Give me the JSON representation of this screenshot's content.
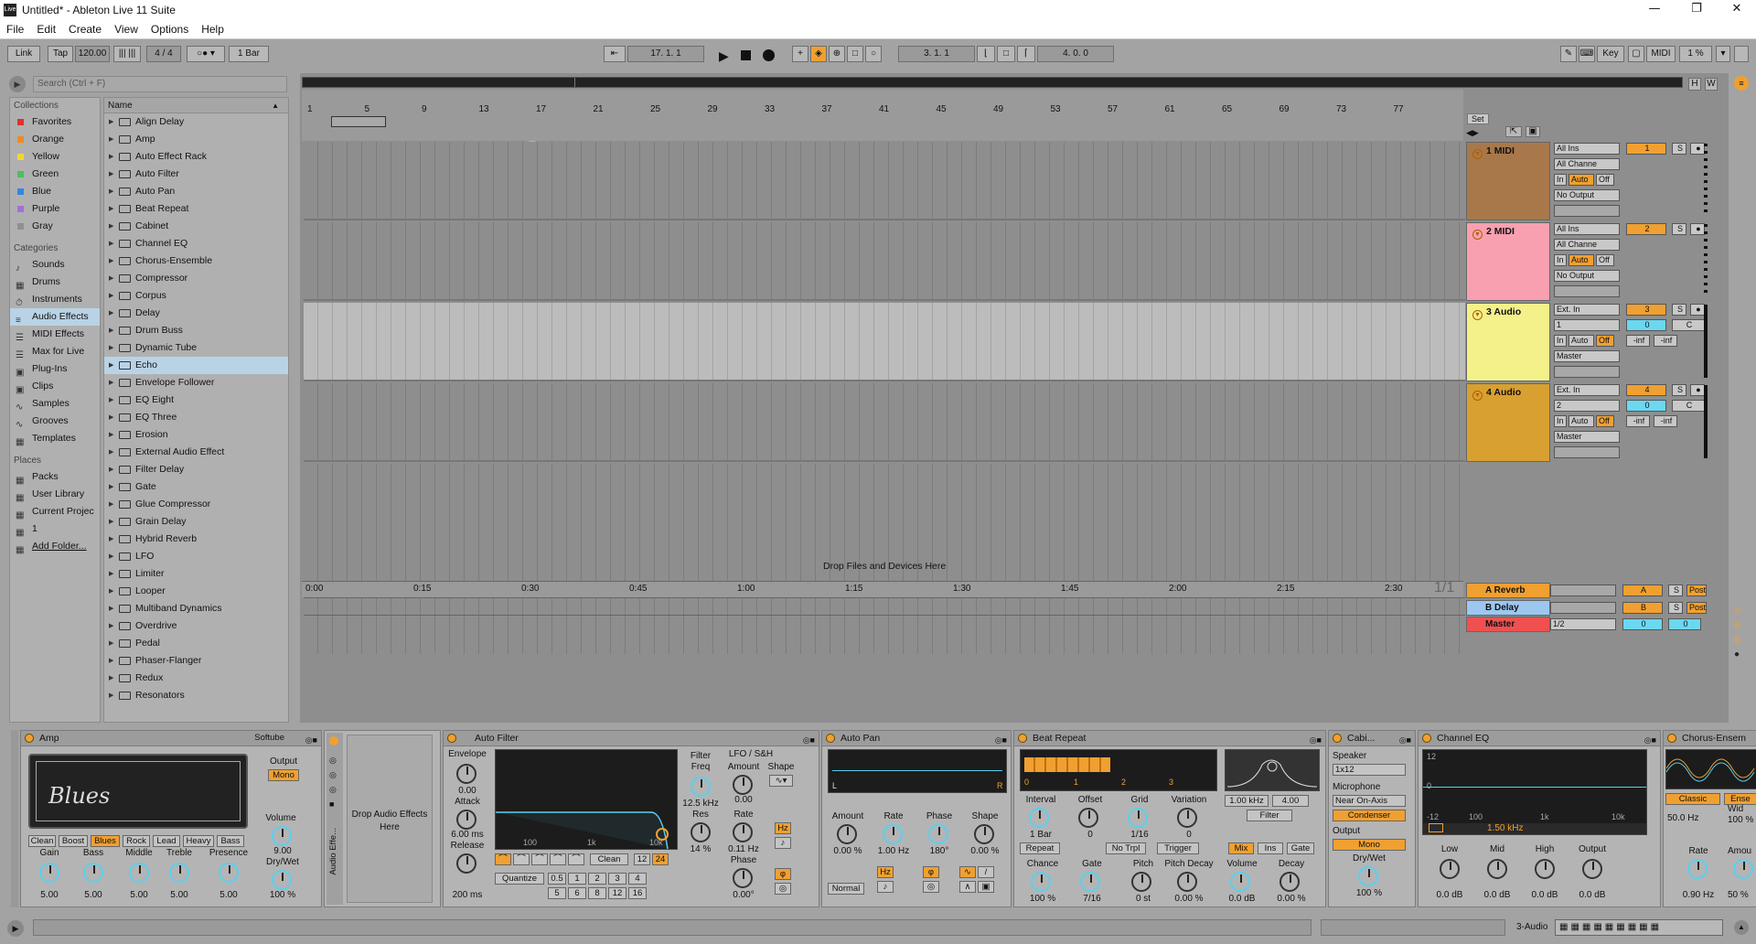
{
  "window": {
    "title": "Untitled* - Ableton Live 11 Suite",
    "app_icon": "Live"
  },
  "menu": [
    "File",
    "Edit",
    "Create",
    "View",
    "Options",
    "Help"
  ],
  "transport": {
    "link": "Link",
    "tap": "Tap",
    "tempo": "120.00",
    "signature": "4 / 4",
    "metronome": "1 Bar",
    "position": "17.   1.   1",
    "loop_start": "3.   1.   1",
    "loop_length": "4.   0.   0",
    "key": "Key",
    "midi": "MIDI",
    "cpu": "1 %"
  },
  "browser": {
    "search_placeholder": "Search (Ctrl + F)",
    "collections_header": "Collections",
    "collections": [
      {
        "label": "Favorites",
        "color": "#e03030"
      },
      {
        "label": "Orange",
        "color": "#f08a20"
      },
      {
        "label": "Yellow",
        "color": "#f0d830"
      },
      {
        "label": "Green",
        "color": "#48c060"
      },
      {
        "label": "Blue",
        "color": "#3088e0"
      },
      {
        "label": "Purple",
        "color": "#a070d8"
      },
      {
        "label": "Gray",
        "color": "#909090"
      }
    ],
    "categories_header": "Categories",
    "categories": [
      "Sounds",
      "Drums",
      "Instruments",
      "Audio Effects",
      "MIDI Effects",
      "Max for Live",
      "Plug-Ins",
      "Clips",
      "Samples",
      "Grooves",
      "Templates"
    ],
    "selected_category": "Audio Effects",
    "places_header": "Places",
    "places": [
      "Packs",
      "User Library",
      "Current Projec",
      "1",
      "Add Folder..."
    ],
    "list_header": "Name",
    "items": [
      "Align Delay",
      "Amp",
      "Auto Effect Rack",
      "Auto Filter",
      "Auto Pan",
      "Beat Repeat",
      "Cabinet",
      "Channel EQ",
      "Chorus-Ensemble",
      "Compressor",
      "Corpus",
      "Delay",
      "Drum Buss",
      "Dynamic Tube",
      "Echo",
      "Envelope Follower",
      "EQ Eight",
      "EQ Three",
      "Erosion",
      "External Audio Effect",
      "Filter Delay",
      "Gate",
      "Glue Compressor",
      "Grain Delay",
      "Hybrid Reverb",
      "LFO",
      "Limiter",
      "Looper",
      "Multiband Dynamics",
      "Overdrive",
      "Pedal",
      "Phaser-Flanger",
      "Redux",
      "Resonators"
    ],
    "selected_item": "Echo"
  },
  "arrangement": {
    "ruler_bars": [
      "1",
      "5",
      "9",
      "13",
      "17",
      "21",
      "25",
      "29",
      "33",
      "37",
      "41",
      "45",
      "49",
      "53",
      "57",
      "61",
      "65",
      "69",
      "73",
      "77"
    ],
    "time_marks": [
      "0:00",
      "0:15",
      "0:30",
      "0:45",
      "1:00",
      "1:15",
      "1:30",
      "1:45",
      "2:00",
      "2:15",
      "2:30"
    ],
    "set_label": "Set",
    "drop_text": "Drop Files and Devices Here",
    "zoom_label": "1/1",
    "tracks": [
      {
        "name": "1 MIDI",
        "color": "#a8784a",
        "input": "All Ins",
        "channel": "All Channe",
        "monitor": [
          "In",
          "Auto",
          "Off"
        ],
        "output": "No Output",
        "number": "1"
      },
      {
        "name": "2 MIDI",
        "color": "#f8a0b0",
        "input": "All Ins",
        "channel": "All Channe",
        "monitor": [
          "In",
          "Auto",
          "Off"
        ],
        "output": "No Output",
        "number": "2"
      },
      {
        "name": "3 Audio",
        "color": "#f4f08a",
        "input": "Ext. In",
        "channel": "1",
        "monitor": [
          "In",
          "Auto",
          "Off"
        ],
        "output": "Master",
        "number": "3",
        "vol": "0",
        "pan": "C",
        "peak_l": "-inf",
        "peak_r": "-inf"
      },
      {
        "name": "4 Audio",
        "color": "#d8a030",
        "input": "Ext. In",
        "channel": "2",
        "monitor": [
          "In",
          "Auto",
          "Off"
        ],
        "output": "Master",
        "number": "4",
        "vol": "0",
        "pan": "C",
        "peak_l": "-inf",
        "peak_r": "-inf"
      }
    ],
    "returns": [
      {
        "name": "A Reverb",
        "color": "#f0a030",
        "letter": "A",
        "post": "Post"
      },
      {
        "name": "B Delay",
        "color": "#9cc8f0",
        "letter": "B",
        "post": "Post"
      }
    ],
    "master": {
      "name": "Master",
      "color": "#f05050",
      "cue": "1/2",
      "vol": "0",
      "pan": "0"
    },
    "solo": "S"
  },
  "devices": {
    "amp": {
      "title": "Amp",
      "preset": "Softube",
      "output": "Output",
      "mono": "Mono",
      "types": [
        "Clean",
        "Boost",
        "Blues",
        "Rock",
        "Lead",
        "Heavy",
        "Bass"
      ],
      "selected": "Blues",
      "logo": "Blues",
      "knobs": [
        {
          "label": "Gain",
          "value": "5.00"
        },
        {
          "label": "Bass",
          "value": "5.00"
        },
        {
          "label": "Middle",
          "value": "5.00"
        },
        {
          "label": "Treble",
          "value": "5.00"
        },
        {
          "label": "Presence",
          "value": "5.00"
        }
      ],
      "volume": {
        "label": "Volume",
        "value": "9.00"
      },
      "drywet": {
        "label": "Dry/Wet",
        "value": "100 %"
      }
    },
    "audio_effects": {
      "title": "Audio Effe...",
      "drop": "Drop Audio Effects Here"
    },
    "auto_filter": {
      "title": "Auto Filter",
      "envelope": "Envelope",
      "env_value": "0.00",
      "attack": "Attack",
      "attack_value": "6.00 ms",
      "release": "Release",
      "release_value": "200 ms",
      "freq_labels": [
        "100",
        "1k",
        "10k"
      ],
      "filter": "Filter",
      "freq": "Freq",
      "freq_value": "12.5 kHz",
      "res": "Res",
      "res_value": "14 %",
      "clean": "Clean",
      "slope12": "12",
      "slope24": "24",
      "quantize": "Quantize",
      "qvals": [
        "0.5",
        "1",
        "2",
        "3",
        "4",
        "5",
        "6",
        "8",
        "12",
        "16"
      ],
      "lfo": "LFO / S&H",
      "amount": "Amount",
      "amount_value": "0.00",
      "shape": "Shape",
      "rate": "Rate",
      "rate_value": "0.11 Hz",
      "phase": "Phase",
      "phase_value": "0.00°",
      "hz": "Hz"
    },
    "auto_pan": {
      "title": "Auto Pan",
      "l": "L",
      "r": "R",
      "amount": "Amount",
      "amount_value": "0.00 %",
      "rate": "Rate",
      "rate_value": "1.00 Hz",
      "phase": "Phase",
      "phase_value": "180°",
      "shape": "Shape",
      "shape_value": "0.00 %",
      "normal": "Normal",
      "hz": "Hz"
    },
    "beat_repeat": {
      "title": "Beat Repeat",
      "ticks": [
        "0",
        "1",
        "2",
        "3"
      ],
      "freq": "1.00 kHz",
      "q": "4.00",
      "filter": "Filter",
      "interval": "Interval",
      "interval_value": "1 Bar",
      "offset": "Offset",
      "offset_value": "0",
      "grid": "Grid",
      "grid_value": "1/16",
      "variation": "Variation",
      "variation_value": "0",
      "repeat": "Repeat",
      "notrpl": "No Trpl",
      "trigger": "Trigger",
      "modes": [
        "Mix",
        "Ins",
        "Gate"
      ],
      "chance": "Chance",
      "chance_value": "100 %",
      "gate": "Gate",
      "gate_value": "7/16",
      "pitch": "Pitch",
      "pitch_value": "0 st",
      "pitch_decay": "Pitch Decay",
      "pitch_decay_value": "0.00 %",
      "volume": "Volume",
      "volume_value": "0.0 dB",
      "decay": "Decay",
      "decay_value": "0.00 %"
    },
    "cabinet": {
      "title": "Cabi...",
      "speaker": "Speaker",
      "speaker_value": "1x12",
      "microphone": "Microphone",
      "mic_value": "Near On-Axis",
      "condenser": "Condenser",
      "output": "Output",
      "mono": "Mono",
      "drywet": "Dry/Wet",
      "drywet_value": "100 %"
    },
    "channel_eq": {
      "title": "Channel EQ",
      "db_top": "12",
      "db_mid": "0",
      "db_bot": "-12",
      "freqs": [
        "100",
        "1k",
        "10k"
      ],
      "freq_value": "1.50 kHz",
      "knobs": [
        {
          "label": "Low",
          "value": "0.0 dB"
        },
        {
          "label": "Mid",
          "value": "0.0 dB"
        },
        {
          "label": "High",
          "value": "0.0 dB"
        },
        {
          "label": "Output",
          "value": "0.0 dB"
        }
      ]
    },
    "chorus": {
      "title": "Chorus-Ensem",
      "classic": "Classic",
      "ens": "Ense",
      "freq_value": "50.0 Hz",
      "wid": "Wid",
      "wid_value": "100 %",
      "rate": "Rate",
      "rate_value": "0.90 Hz",
      "amount": "Amou",
      "amount_value": "50 %"
    }
  },
  "status": {
    "track": "3-Audio"
  }
}
